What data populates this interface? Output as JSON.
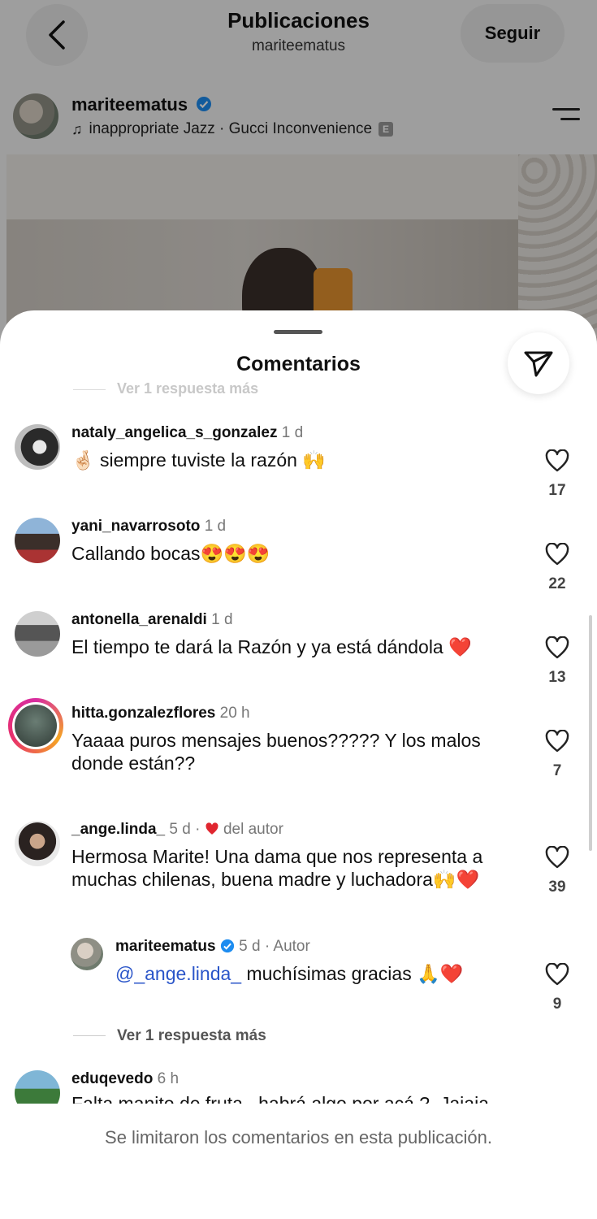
{
  "header": {
    "title": "Publicaciones",
    "subtitle": "mariteematus",
    "follow_label": "Seguir"
  },
  "post": {
    "author": "mariteematus",
    "music_title": "inappropriate Jazz",
    "music_separator": " · ",
    "music_artist": "Gucci Inconvenience",
    "explicit_badge": "E"
  },
  "sheet": {
    "title": "Comentarios",
    "ghost_more_replies": "Ver 1 respuesta más",
    "footer_text": "Se limitaron los comentarios en esta publicación."
  },
  "comments": [
    {
      "user": "nataly_angelica_s_gonzalez",
      "time": "1 d",
      "text": "🤞🏻 siempre tuviste la razón 🙌",
      "likes": "17"
    },
    {
      "user": "yani_navarrosoto",
      "time": "1 d",
      "text": "Callando bocas😍😍😍",
      "likes": "22"
    },
    {
      "user": "antonella_arenaldi",
      "time": "1 d",
      "text": "El tiempo te dará la Razón y ya está dándola ❤️",
      "likes": "13"
    },
    {
      "user": "hitta.gonzalezflores",
      "time": "20 h",
      "text": "Yaaaa puros mensajes buenos????? Y los malos donde están??",
      "likes": "7"
    },
    {
      "user": "_ange.linda_",
      "time": "5 d",
      "liked_by_author": "del autor",
      "text": "Hermosa Marite! Una dama que nos representa a muchas chilenas, buena madre y luchadora🙌❤️",
      "likes": "39"
    }
  ],
  "reply": {
    "user": "mariteematus",
    "time": "5 d",
    "role": "Autor",
    "mention": "@_ange.linda_",
    "text": " muchísimas gracias 🙏❤️",
    "likes": "9",
    "more_replies": "Ver 1 respuesta más"
  },
  "partial_comment": {
    "user": "eduqevedo",
    "time": "6 h",
    "text": "Falta manito de fruta...habrá algo por acá ?. Jajaja"
  },
  "colors": {
    "link": "#2a55c9",
    "heart": "#e0262f",
    "verified": "#1d8cf0"
  }
}
